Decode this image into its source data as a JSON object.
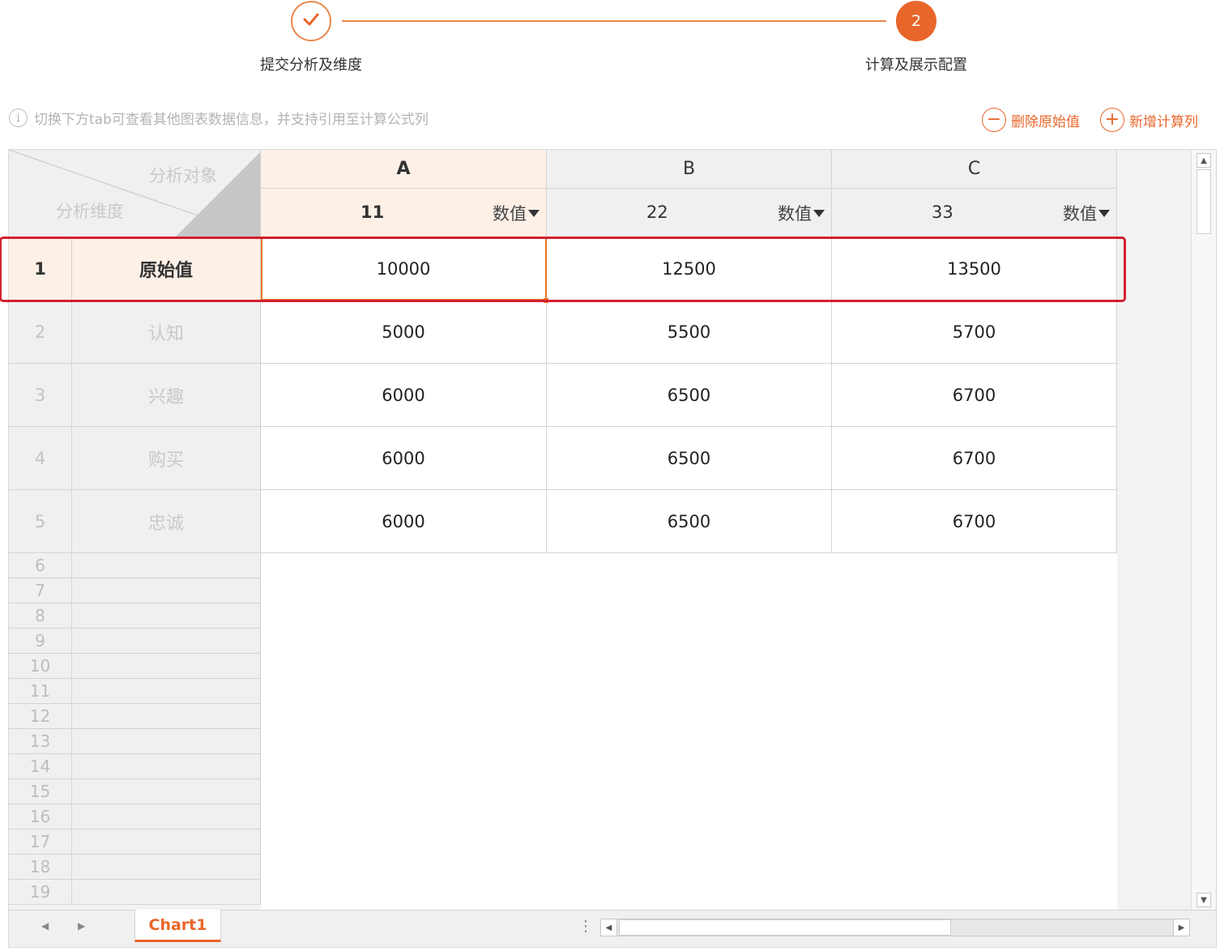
{
  "stepper": {
    "steps": [
      {
        "label": "提交分析及维度",
        "status": "done",
        "icon": "check-icon"
      },
      {
        "label": "计算及展示配置",
        "status": "current",
        "number": "2"
      }
    ],
    "accent": "#e8662a"
  },
  "info": {
    "icon": "info-icon",
    "text": "切换下方tab可查看其他图表数据信息，并支持引用至计算公式列"
  },
  "actions": {
    "remove_original": {
      "icon": "minus-circle-icon",
      "label": "删除原始值"
    },
    "add_column": {
      "icon": "plus-circle-icon",
      "label": "新增计算列"
    }
  },
  "sheet": {
    "corner": {
      "top_label": "分析对象",
      "bottom_label": "分析维度"
    },
    "columns": [
      {
        "letter": "A",
        "name": "11",
        "type": "数值"
      },
      {
        "letter": "B",
        "name": "22",
        "type": "数值"
      },
      {
        "letter": "C",
        "name": "33",
        "type": "数值"
      }
    ],
    "rows": [
      {
        "num": "1",
        "name": "原始值",
        "values": [
          "10000",
          "12500",
          "13500"
        ]
      },
      {
        "num": "2",
        "name": "认知",
        "values": [
          "5000",
          "5500",
          "5700"
        ]
      },
      {
        "num": "3",
        "name": "兴趣",
        "values": [
          "6000",
          "6500",
          "6700"
        ]
      },
      {
        "num": "4",
        "name": "购买",
        "values": [
          "6000",
          "6500",
          "6700"
        ]
      },
      {
        "num": "5",
        "name": "忠诚",
        "values": [
          "6000",
          "6500",
          "6700"
        ]
      }
    ],
    "empty_rows": [
      "6",
      "7",
      "8",
      "9",
      "10",
      "11",
      "12",
      "13",
      "14",
      "15",
      "16",
      "17",
      "18",
      "19"
    ],
    "selected_row": "1",
    "selected_column": "A",
    "highlight_color": "#d32030"
  },
  "tabs": {
    "items": [
      "Chart1"
    ],
    "active": "Chart1",
    "more_icon": "vertical-dots-icon"
  }
}
